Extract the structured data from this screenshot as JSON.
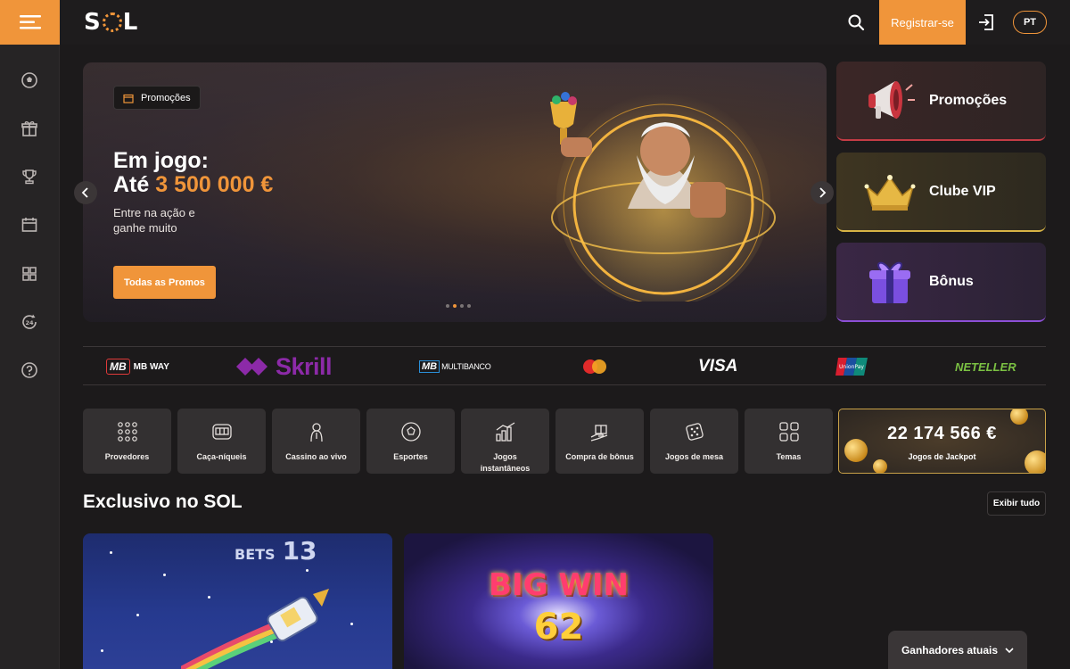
{
  "brand": {
    "logo_text": "SOL",
    "accent": "#f0953a"
  },
  "topbar": {
    "register_label": "Registrar-se",
    "language": "PT"
  },
  "sidebar": {
    "items": [
      {
        "icon": "soccer-ball-icon"
      },
      {
        "icon": "gift-icon"
      },
      {
        "icon": "trophy-icon"
      },
      {
        "icon": "calendar-icon"
      },
      {
        "icon": "grid-icon"
      },
      {
        "icon": "support-24-icon"
      },
      {
        "icon": "help-icon"
      }
    ]
  },
  "hero": {
    "tag": "Promoções",
    "title_line1": "Em jogo:",
    "title_prefix": "Até",
    "amount": "3 500 000 €",
    "subtitle": "Entre na ação e ganhe muito",
    "cta": "Todas as Promos",
    "slides_total": 4,
    "active_slide": 2
  },
  "side_cards": [
    {
      "label": "Promoções",
      "icon": "megaphone-icon"
    },
    {
      "label": "Clube VIP",
      "icon": "crown-icon"
    },
    {
      "label": "Bônus",
      "icon": "gift-box-icon"
    }
  ],
  "payments": [
    "MB WAY",
    "Skrill",
    "MULTIBANCO",
    "Mastercard",
    "VISA",
    "UnionPay",
    "NETELLER"
  ],
  "categories": [
    {
      "label": "Provedores",
      "icon": "dots-grid-icon"
    },
    {
      "label": "Caça-níqueis",
      "icon": "slot-machine-icon"
    },
    {
      "label": "Cassino ao vivo",
      "icon": "live-dealer-icon"
    },
    {
      "label": "Esportes",
      "icon": "soccer-ball-icon"
    },
    {
      "label": "Jogos instantâneos",
      "icon": "bar-chart-icon"
    },
    {
      "label": "Compra de bônus",
      "icon": "bonus-buy-icon"
    },
    {
      "label": "Jogos de mesa",
      "icon": "dice-icon"
    },
    {
      "label": "Temas",
      "icon": "themes-grid-icon"
    }
  ],
  "jackpot": {
    "value": "22 174 566 €",
    "label": "Jogos de Jackpot"
  },
  "section": {
    "title": "Exclusivo no SOL",
    "see_all": "Exibir tudo"
  },
  "games": [
    {
      "bets_label": "BETS",
      "bets_value": "13"
    },
    {
      "big_win_label": "BIG WIN",
      "big_win_value": "62"
    }
  ],
  "winners": {
    "label": "Ganhadores atuais"
  }
}
